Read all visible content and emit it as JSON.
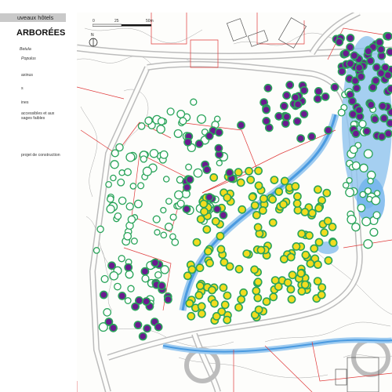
{
  "legend": {
    "title": "uveaux hôtels",
    "heading": "ARBORÉES",
    "items": [
      {
        "text": "Betula",
        "italic": true
      },
      {
        "text": "Populus",
        "italic": true
      },
      {
        "text": "axinus",
        "italic": false
      },
      {
        "text": "s",
        "italic": false
      },
      {
        "text": "ines",
        "italic": false
      },
      {
        "text": "accessibles et aux",
        "italic": false
      },
      {
        "text": "sages faibles",
        "italic": false
      },
      {
        "text": "projet de construction",
        "italic": false
      }
    ]
  },
  "scale": {
    "labels": [
      "0",
      "25",
      "50m"
    ]
  },
  "north": {
    "label": "N"
  },
  "colors": {
    "purple": "#6a1b8f",
    "yellow": "#f2dc1f",
    "green": "#2aa45a",
    "water": "#4a9ae0",
    "parcel": "#e03a3a",
    "road": "#bdbdbd",
    "contour": "#9a9a9a"
  }
}
